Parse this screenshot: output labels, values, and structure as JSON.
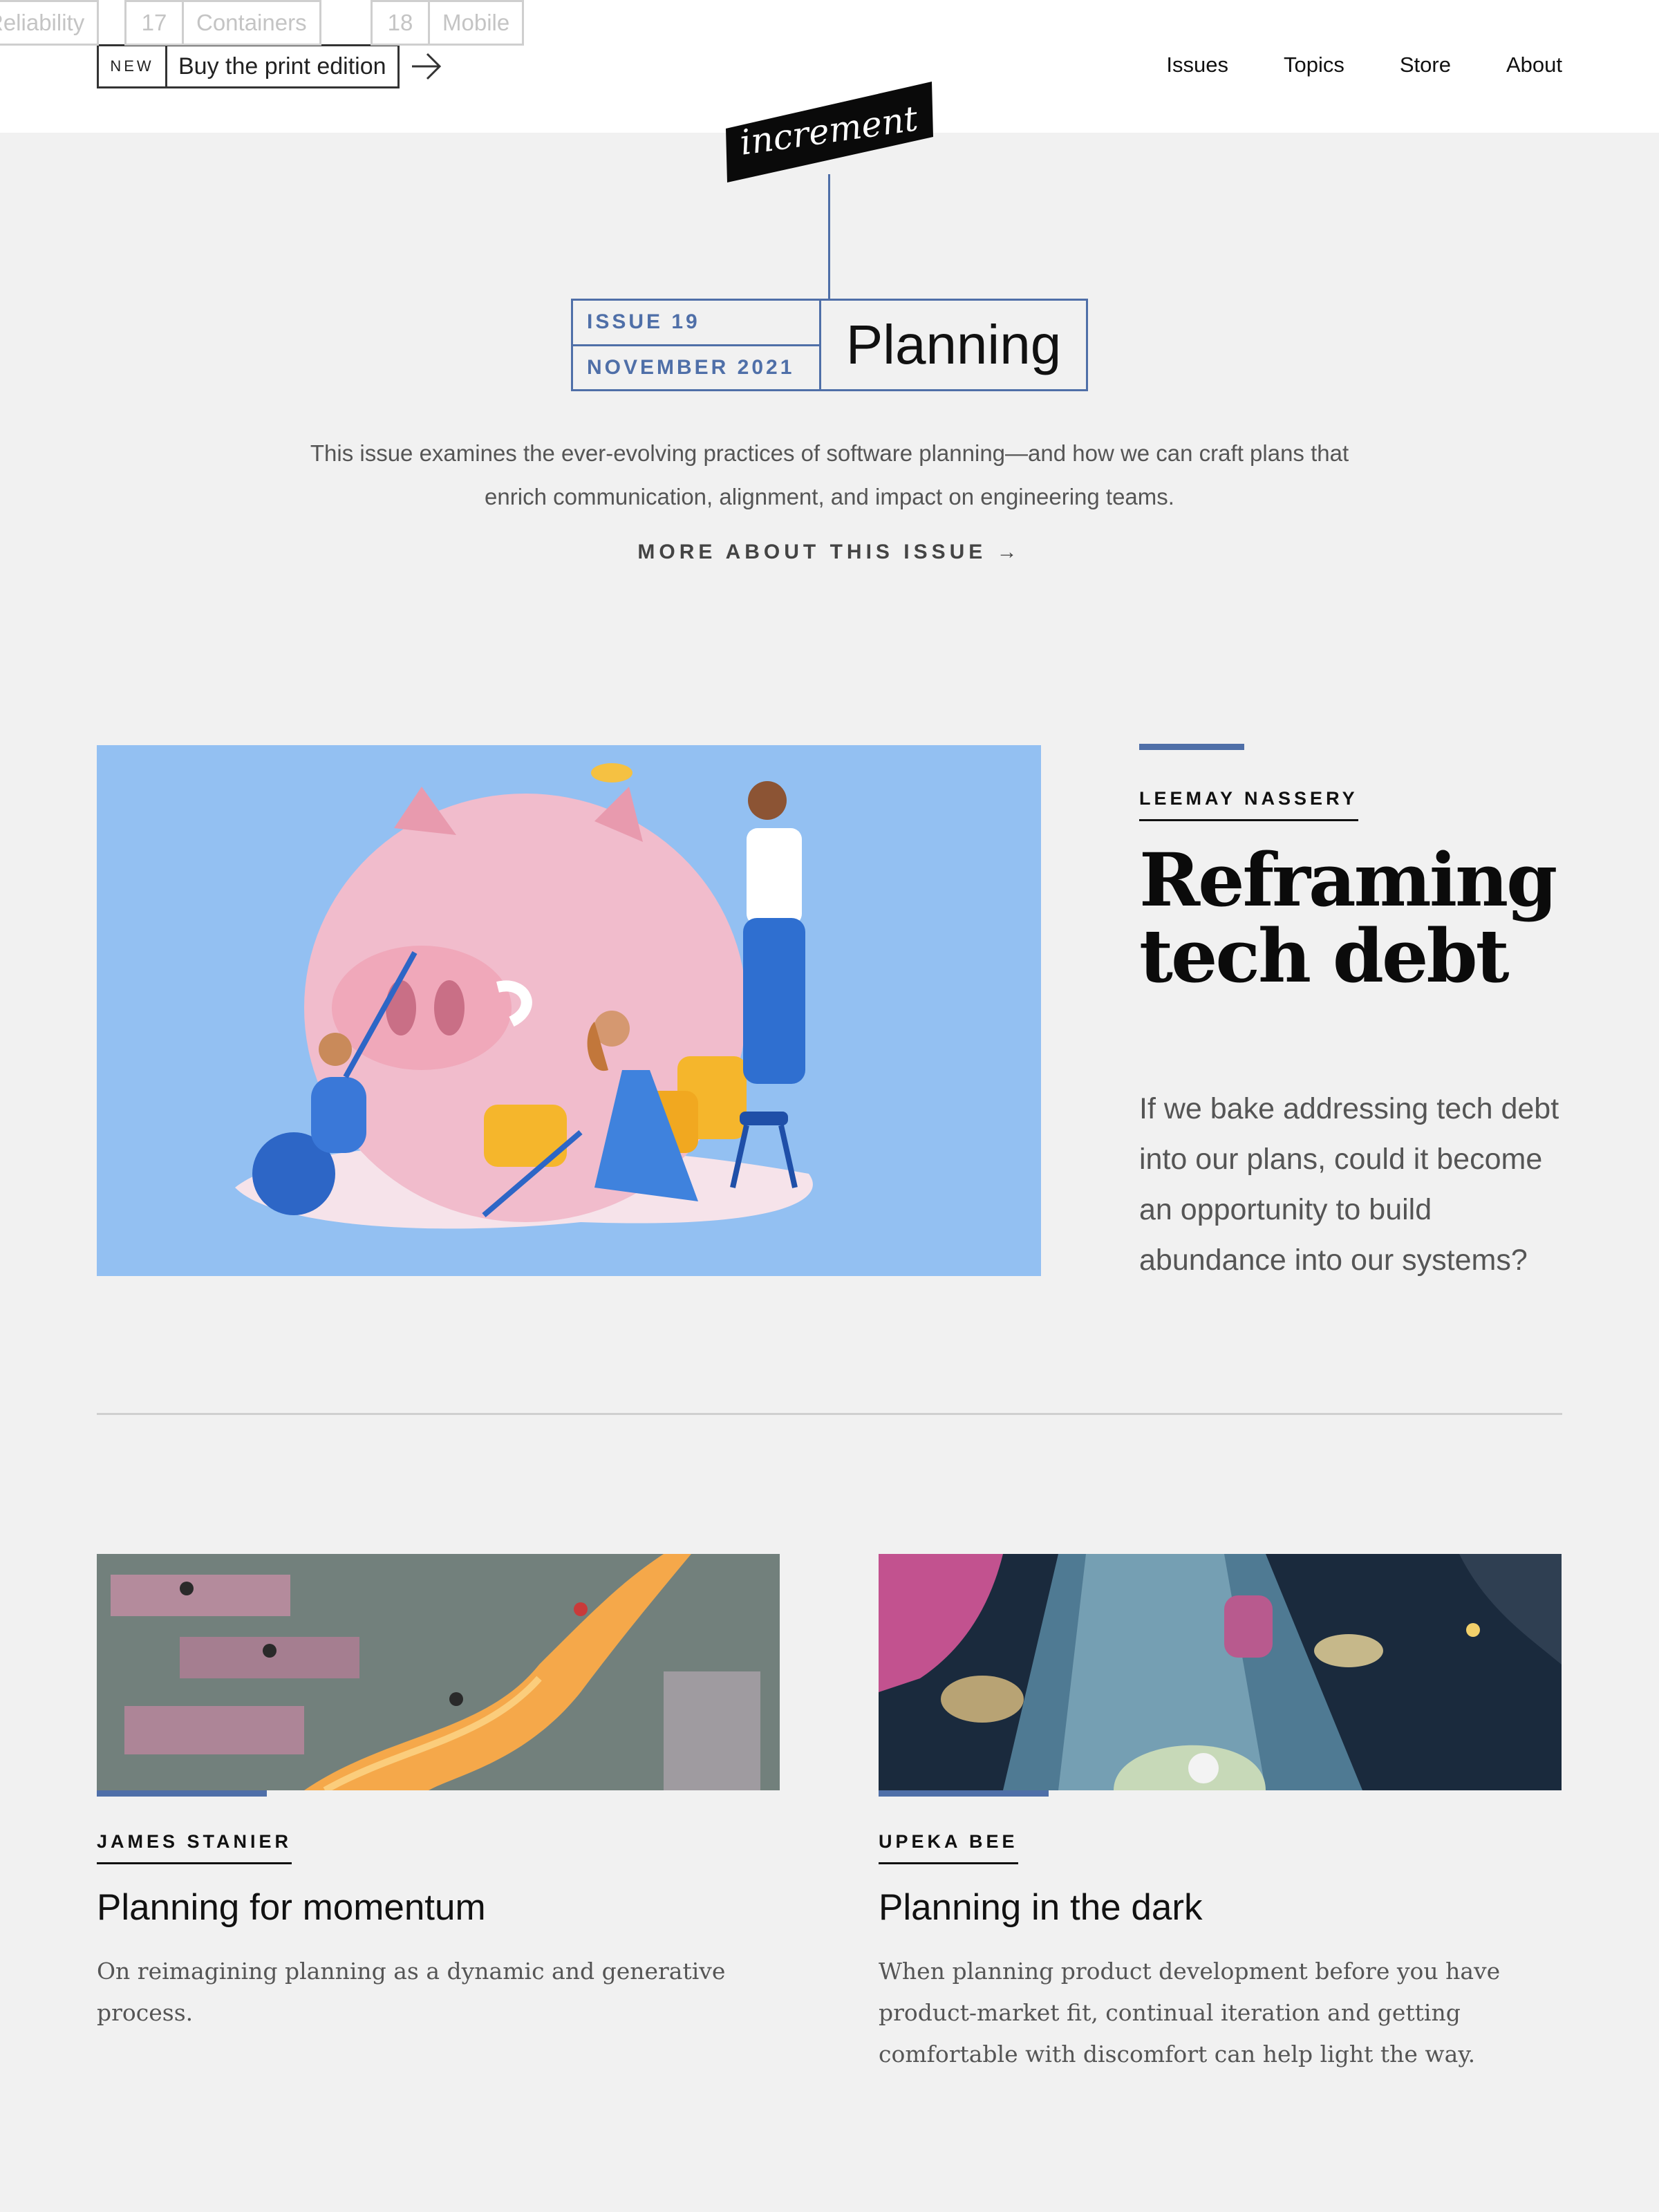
{
  "header": {
    "print_badge": "NEW",
    "print_label": "Buy the print edition",
    "nav": [
      {
        "label": "Issues"
      },
      {
        "label": "Topics"
      },
      {
        "label": "Store"
      },
      {
        "label": "About"
      }
    ]
  },
  "logo": {
    "text": "increment"
  },
  "issue_tabs": [
    {
      "number": "",
      "name": "Reliability"
    },
    {
      "number": "17",
      "name": "Containers"
    },
    {
      "number": "18",
      "name": "Mobile"
    }
  ],
  "current_issue": {
    "issue_label": "ISSUE 19",
    "date_label": "NOVEMBER 2021",
    "title": "Planning",
    "description": "This issue examines the ever-evolving practices of software planning—and how we can craft plans that enrich communication, alignment, and impact on engineering teams.",
    "more_link": "MORE ABOUT THIS ISSUE →"
  },
  "feature": {
    "author": "LEEMAY NASSERY",
    "title": "Reframing tech debt",
    "dek": "If we bake addressing tech debt into our plans, could it become an opportunity to build abundance into our systems?"
  },
  "cards": [
    {
      "author": "JAMES STANIER",
      "title": "Planning for momentum",
      "dek": "On reimagining planning as a dynamic and generative process."
    },
    {
      "author": "UPEKA BEE",
      "title": "Planning in the dark",
      "dek": "When planning product development before you have product-market fit, continual iteration and getting comfortable with discomfort can help light the way."
    }
  ],
  "colors": {
    "accent": "#4f6fa8",
    "background": "#f1f1f1",
    "feature_bg": "#93c0f2"
  }
}
